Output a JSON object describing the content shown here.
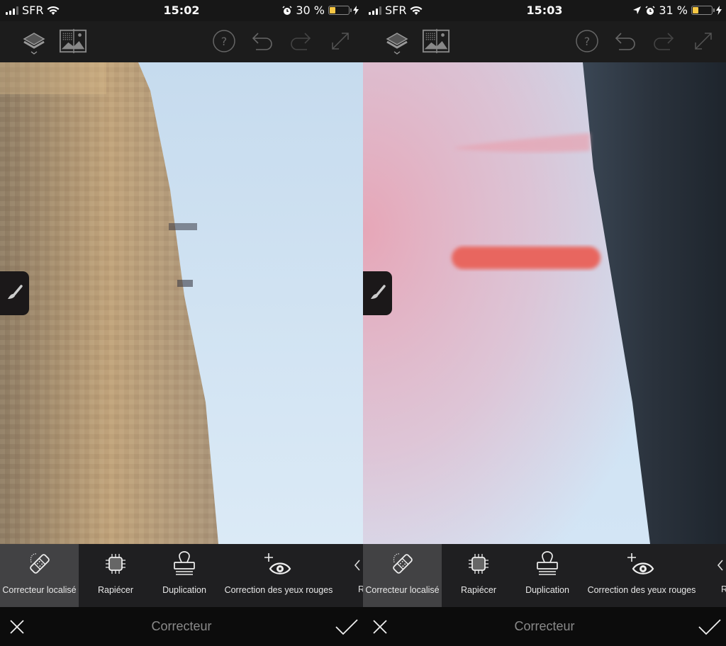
{
  "screens": [
    {
      "status": {
        "carrier": "SFR",
        "time": "15:02",
        "battery_text": "30 %",
        "battery_fraction": 0.3,
        "icons": [
          "signal-icon",
          "wifi-icon",
          "alarm-icon",
          "battery-icon",
          "charging-icon"
        ]
      },
      "toolbar": {
        "left_icons": [
          "layers-icon",
          "compare-icon"
        ],
        "right_icons": [
          "help-icon",
          "undo-icon",
          "redo-icon",
          "expand-icon"
        ]
      },
      "tools": [
        {
          "label": "Correcteur localisé",
          "icon": "bandage-icon",
          "active": true
        },
        {
          "label": "Rapiécer",
          "icon": "patch-icon",
          "active": false
        },
        {
          "label": "Duplication",
          "icon": "stamp-icon",
          "active": false
        },
        {
          "label": "Correction des yeux rouges",
          "icon": "red-eye-icon",
          "active": false
        }
      ],
      "more_label": "R",
      "bottom": {
        "title": "Correcteur",
        "cancel": "cancel-icon",
        "confirm": "check-icon"
      }
    },
    {
      "status": {
        "carrier": "SFR",
        "time": "15:03",
        "battery_text": "31 %",
        "battery_fraction": 0.31,
        "icons": [
          "signal-icon",
          "wifi-icon",
          "location-icon",
          "alarm-icon",
          "battery-icon",
          "charging-icon"
        ]
      },
      "toolbar": {
        "left_icons": [
          "layers-icon",
          "compare-icon"
        ],
        "right_icons": [
          "help-icon",
          "undo-icon",
          "redo-icon",
          "expand-icon"
        ]
      },
      "tools": [
        {
          "label": "Correcteur localisé",
          "icon": "bandage-icon",
          "active": true
        },
        {
          "label": "Rapiécer",
          "icon": "patch-icon",
          "active": false
        },
        {
          "label": "Duplication",
          "icon": "stamp-icon",
          "active": false
        },
        {
          "label": "Correction des yeux rouges",
          "icon": "red-eye-icon",
          "active": false
        }
      ],
      "more_label": "R",
      "bottom": {
        "title": "Correcteur",
        "cancel": "cancel-icon",
        "confirm": "check-icon"
      }
    }
  ],
  "colors": {
    "battery_fill": "#f7c744",
    "brush_stroke": "#e8665f",
    "mask_overlay": "#e8a3b4",
    "sky": "#cfe2f3"
  }
}
